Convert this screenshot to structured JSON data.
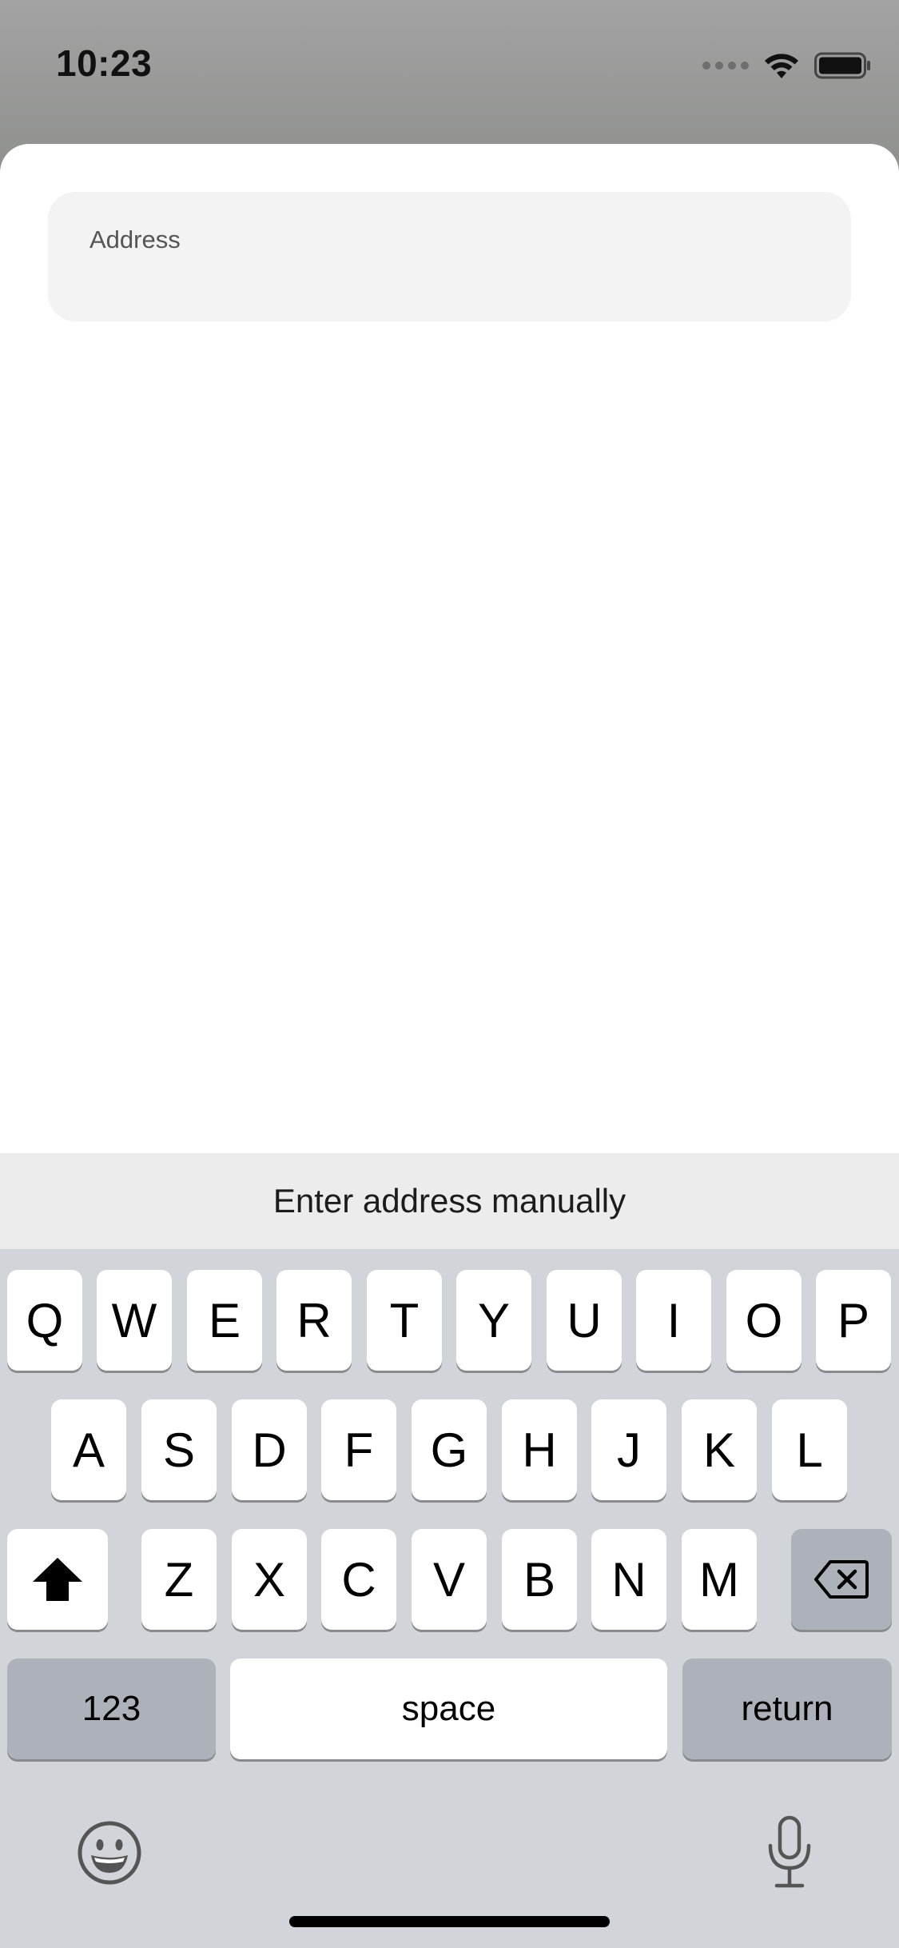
{
  "status_bar": {
    "time": "10:23",
    "icons": [
      "signal-dots-icon",
      "wifi-icon",
      "battery-icon"
    ]
  },
  "form": {
    "address_label": "Address",
    "address_value": "",
    "address_placeholder": ""
  },
  "accessory": {
    "label": "Enter address manually"
  },
  "keyboard": {
    "row1": [
      "Q",
      "W",
      "E",
      "R",
      "T",
      "Y",
      "U",
      "I",
      "O",
      "P"
    ],
    "row2": [
      "A",
      "S",
      "D",
      "F",
      "G",
      "H",
      "J",
      "K",
      "L"
    ],
    "row3": [
      "Z",
      "X",
      "C",
      "V",
      "B",
      "N",
      "M"
    ],
    "shift_icon": "shift-icon",
    "delete_icon": "delete-icon",
    "numbers_label": "123",
    "space_label": "space",
    "return_label": "return",
    "emoji_icon": "emoji-icon",
    "mic_icon": "microphone-icon"
  },
  "colors": {
    "keyboard_bg": "#d1d4d9",
    "key_bg": "#ffffff",
    "function_key_bg": "#acb1ba",
    "accessory_bg": "#ececec",
    "field_bg": "#f3f3f3"
  }
}
